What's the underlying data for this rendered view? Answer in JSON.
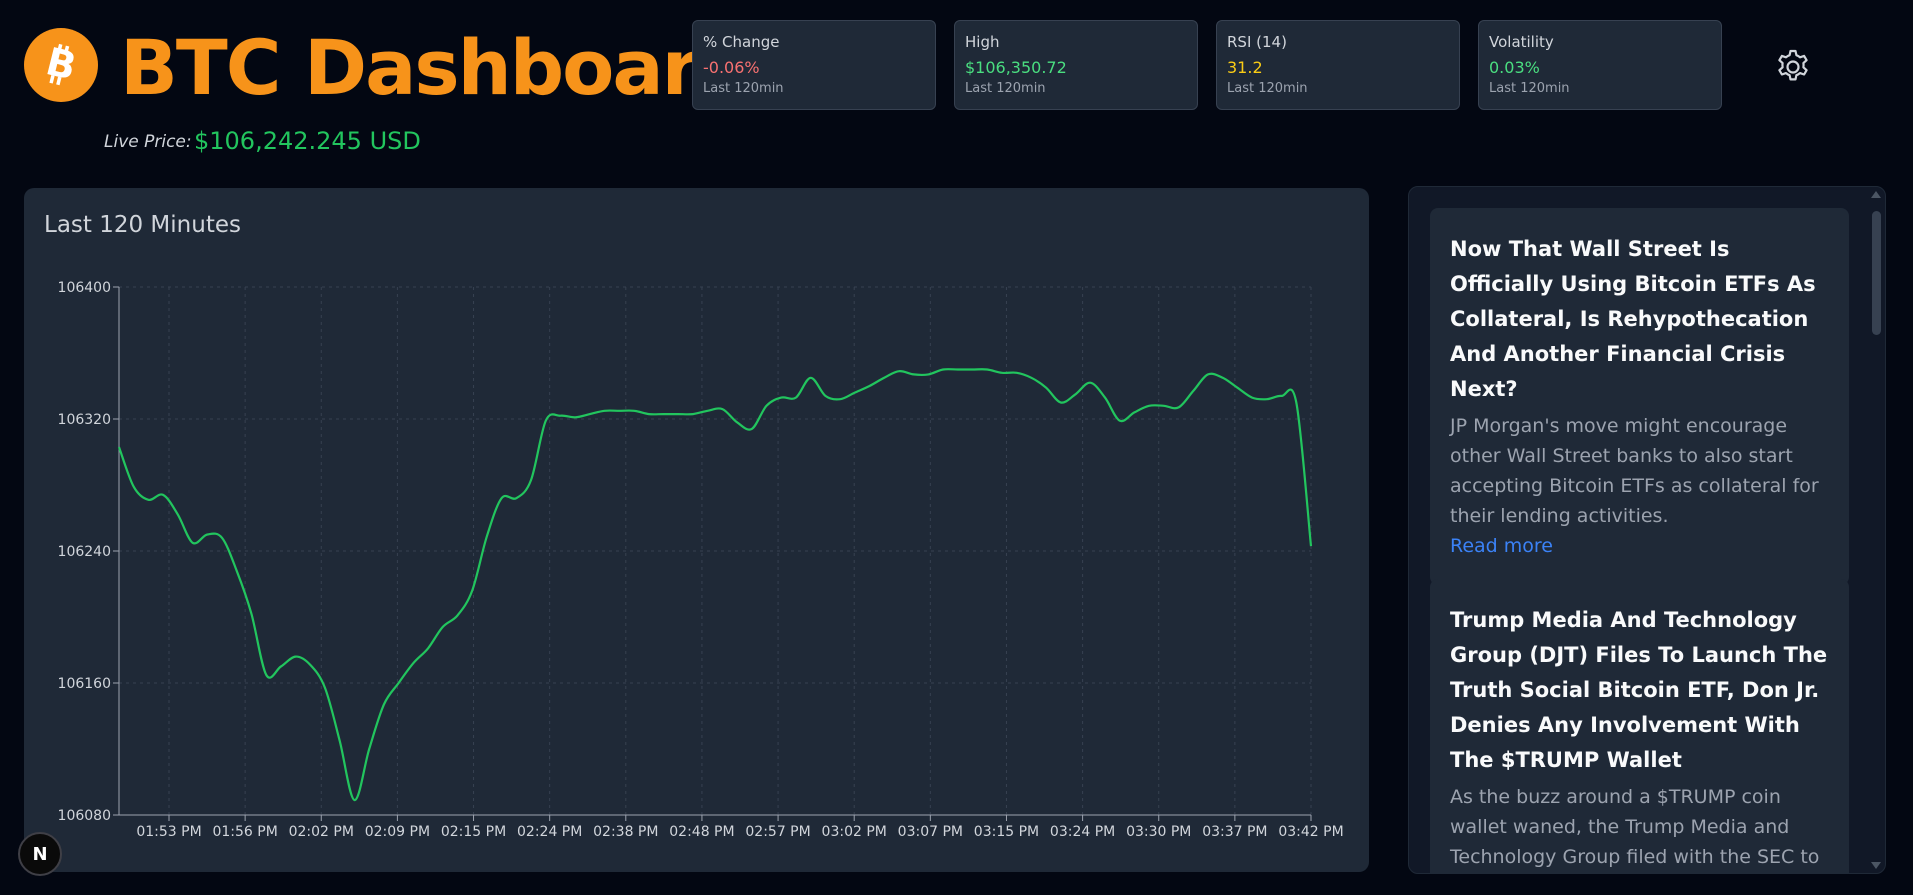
{
  "header": {
    "title": "BTC Dashboard",
    "logo_icon": "bitcoin-icon",
    "live_label": "Live Price:",
    "live_price": "$106,242.245 USD"
  },
  "stats": [
    {
      "label": "% Change",
      "value": "-0.06%",
      "sub": "Last 120min",
      "color": "#f87171"
    },
    {
      "label": "High",
      "value": "$106,350.72",
      "sub": "Last 120min",
      "color": "#4ade80"
    },
    {
      "label": "RSI (14)",
      "value": "31.2",
      "sub": "Last 120min",
      "color": "#facc15"
    },
    {
      "label": "Volatility",
      "value": "0.03%",
      "sub": "Last 120min",
      "color": "#4ade80"
    }
  ],
  "settings_icon": "gear-icon",
  "chart_panel": {
    "title": "Last 120 Minutes"
  },
  "chart_data": {
    "type": "line",
    "title": "Last 120 Minutes",
    "ylim": [
      106080,
      106400
    ],
    "yticks": [
      106400,
      106320,
      106240,
      106160,
      106080
    ],
    "xticks": [
      "01:53 PM",
      "01:56 PM",
      "02:02 PM",
      "02:09 PM",
      "02:15 PM",
      "02:24 PM",
      "02:38 PM",
      "02:48 PM",
      "02:57 PM",
      "03:02 PM",
      "03:07 PM",
      "03:15 PM",
      "03:24 PM",
      "03:30 PM",
      "03:37 PM",
      "03:42 PM"
    ],
    "grid": true,
    "line_color": "#22c55e",
    "series": [
      {
        "values": [
          106303,
          106279,
          106271,
          106274,
          106262,
          106245,
          106250,
          106248,
          106228,
          106202,
          106165,
          106170,
          106176,
          106171,
          106157,
          106125,
          106089,
          106120,
          106147,
          106160,
          106172,
          106181,
          106194,
          106201,
          106216,
          106249,
          106272,
          106272,
          106283,
          106319,
          106322,
          106321,
          106323,
          106325,
          106325,
          106325,
          106323,
          106323,
          106323,
          106323,
          106325,
          106326,
          106318,
          106314,
          106328,
          106333,
          106333,
          106345,
          106334,
          106332,
          106336,
          106340,
          106345,
          106349,
          106347,
          106347,
          106350,
          106350,
          106350,
          106350,
          106348,
          106348,
          106345,
          106339,
          106330,
          106335,
          106342,
          106333,
          106319,
          106324,
          106328,
          106328,
          106327,
          106337,
          106347,
          106345,
          106339,
          106333,
          106332,
          106334,
          106330,
          106243
        ]
      }
    ]
  },
  "news": [
    {
      "title": "Now That Wall Street Is Officially Using Bitcoin ETFs As Collateral, Is Rehypothecation And Another Financial Crisis Next?",
      "description": "JP Morgan's move might encourage other Wall Street banks to also start accepting Bitcoin ETFs as collateral for their lending activities.",
      "link": "Read more"
    },
    {
      "title": "Trump Media And Technology Group (DJT) Files To Launch The Truth Social Bitcoin ETF, Don Jr. Denies Any Involvement With The $TRUMP Wallet",
      "description": "As the buzz around a $TRUMP coin wallet waned, the Trump Media and Technology Group filed with the SEC to launch the"
    }
  ],
  "next_badge": "N"
}
